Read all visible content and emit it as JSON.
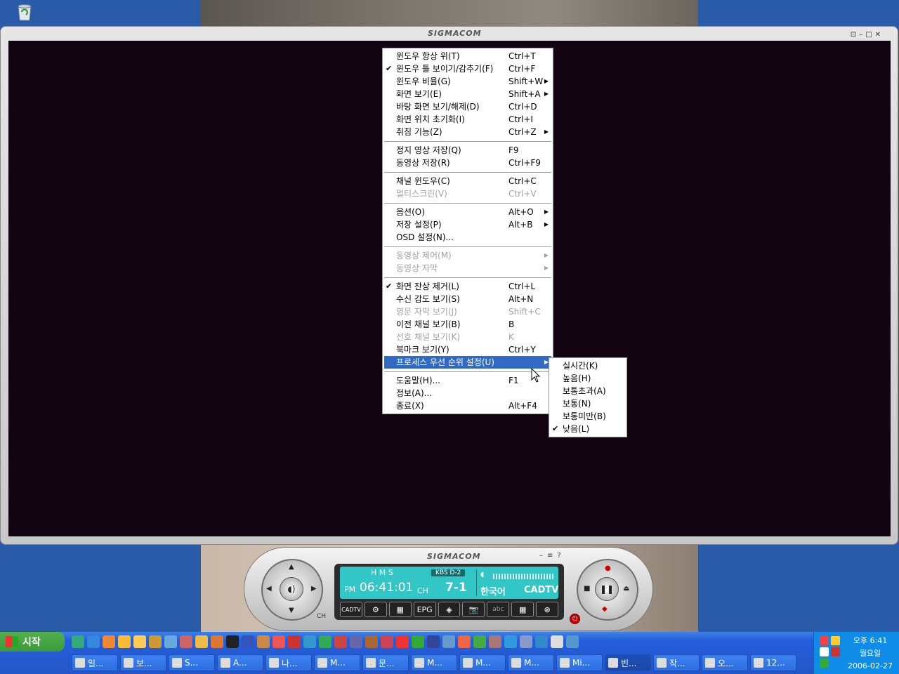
{
  "desktop": {
    "recycle_bin_icon": "recycle-bin-icon"
  },
  "player": {
    "brand": "SIGMACOM",
    "window_controls": [
      "⊡",
      "–",
      "□",
      "✕"
    ]
  },
  "context_menu": {
    "items": [
      {
        "label": "윈도우 항상 위(T)",
        "shortcut": "Ctrl+T",
        "checked": false,
        "disabled": false,
        "submenu": false
      },
      {
        "label": "윈도우 틀 보이기/감추기(F)",
        "shortcut": "Ctrl+F",
        "checked": true,
        "disabled": false,
        "submenu": false
      },
      {
        "label": "윈도우 비율(G)",
        "shortcut": "Shift+W",
        "checked": false,
        "disabled": false,
        "submenu": true
      },
      {
        "label": "화면 보기(E)",
        "shortcut": "Shift+A",
        "checked": false,
        "disabled": false,
        "submenu": true
      },
      {
        "label": "바탕 화면 보기/해제(D)",
        "shortcut": "Ctrl+D",
        "checked": false,
        "disabled": false,
        "submenu": false
      },
      {
        "label": "화면 위치 초기화(I)",
        "shortcut": "Ctrl+I",
        "checked": false,
        "disabled": false,
        "submenu": false
      },
      {
        "label": "취침 기능(Z)",
        "shortcut": "Ctrl+Z",
        "checked": false,
        "disabled": false,
        "submenu": true
      },
      {
        "sep": true
      },
      {
        "label": "정지 영상 저장(Q)",
        "shortcut": "F9",
        "checked": false,
        "disabled": false,
        "submenu": false
      },
      {
        "label": "동영상 저장(R)",
        "shortcut": "Ctrl+F9",
        "checked": false,
        "disabled": false,
        "submenu": false
      },
      {
        "sep": true
      },
      {
        "label": "채널 윈도우(C)",
        "shortcut": "Ctrl+C",
        "checked": false,
        "disabled": false,
        "submenu": false
      },
      {
        "label": "멀티스크린(V)",
        "shortcut": "Ctrl+V",
        "checked": false,
        "disabled": true,
        "submenu": false
      },
      {
        "sep": true
      },
      {
        "label": "옵션(O)",
        "shortcut": "Alt+O",
        "checked": false,
        "disabled": false,
        "submenu": true
      },
      {
        "label": "저장 설정(P)",
        "shortcut": "Alt+B",
        "checked": false,
        "disabled": false,
        "submenu": true
      },
      {
        "label": "OSD 설정(N)...",
        "shortcut": "",
        "checked": false,
        "disabled": false,
        "submenu": false
      },
      {
        "sep": true
      },
      {
        "label": "동영상 제어(M)",
        "shortcut": "",
        "checked": false,
        "disabled": true,
        "submenu": true
      },
      {
        "label": "동영상 자막",
        "shortcut": "",
        "checked": false,
        "disabled": true,
        "submenu": true
      },
      {
        "sep": true
      },
      {
        "label": "화면 잔상 제거(L)",
        "shortcut": "Ctrl+L",
        "checked": true,
        "disabled": false,
        "submenu": false
      },
      {
        "label": "수신 감도 보기(S)",
        "shortcut": "Alt+N",
        "checked": false,
        "disabled": false,
        "submenu": false
      },
      {
        "label": "영문 자막 보기(J)",
        "shortcut": "Shift+C",
        "checked": false,
        "disabled": true,
        "submenu": false
      },
      {
        "label": "이전 채널 보기(B)",
        "shortcut": "B",
        "checked": false,
        "disabled": false,
        "submenu": false
      },
      {
        "label": "선호 채널 보기(K)",
        "shortcut": "K",
        "checked": false,
        "disabled": true,
        "submenu": false
      },
      {
        "label": "북마크 보기(Y)",
        "shortcut": "Ctrl+Y",
        "checked": false,
        "disabled": false,
        "submenu": false
      },
      {
        "label": "프로세스 우선 순위 설정(U)",
        "shortcut": "",
        "checked": false,
        "disabled": false,
        "submenu": true,
        "highlighted": true
      },
      {
        "sep": true
      },
      {
        "label": "도움말(H)...",
        "shortcut": "F1",
        "checked": false,
        "disabled": false,
        "submenu": false
      },
      {
        "label": "정보(A)...",
        "shortcut": "",
        "checked": false,
        "disabled": false,
        "submenu": false
      },
      {
        "label": "종료(X)",
        "shortcut": "Alt+F4",
        "checked": false,
        "disabled": false,
        "submenu": false
      }
    ]
  },
  "submenu": {
    "items": [
      {
        "label": "실시간(K)",
        "checked": false
      },
      {
        "label": "높음(H)",
        "checked": false
      },
      {
        "label": "보통초과(A)",
        "checked": false
      },
      {
        "label": "보통(N)",
        "checked": false
      },
      {
        "label": "보통미만(B)",
        "checked": false
      },
      {
        "label": "낮음(L)",
        "checked": true
      }
    ]
  },
  "control_panel": {
    "brand": "SIGMACOM",
    "top_buttons": [
      "–",
      "≡",
      "?"
    ],
    "lcd": {
      "hms": "H   M   S",
      "ampm": "PM",
      "time": "06:41:01",
      "station": "KBS D-2",
      "ch_label": "CH",
      "channel": "7-1",
      "language": "한국어",
      "mode": "CADTV"
    },
    "buttons": [
      "CADTV",
      "⚙",
      "▦",
      "EPG",
      "◈",
      "📷",
      "abc",
      "▦",
      "⊗"
    ],
    "ch_label": "CH"
  },
  "taskbar": {
    "start_label": "시작",
    "tasks": [
      {
        "label": "일..."
      },
      {
        "label": "보..."
      },
      {
        "label": "S..."
      },
      {
        "label": "A..."
      },
      {
        "label": "나..."
      },
      {
        "label": "M..."
      },
      {
        "label": "문..."
      },
      {
        "label": "M..."
      },
      {
        "label": "M..."
      },
      {
        "label": "M..."
      },
      {
        "label": "Mi..."
      },
      {
        "label": "빈...",
        "active": true
      },
      {
        "label": "작..."
      },
      {
        "label": "오..."
      },
      {
        "label": "12..."
      }
    ],
    "clock": {
      "time": "오후 6:41",
      "day": "월요일",
      "date": "2006-02-27"
    }
  }
}
